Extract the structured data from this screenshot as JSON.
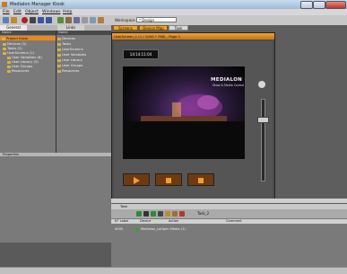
{
  "window": {
    "title": "Medialon Manager Kiosk"
  },
  "menu": {
    "items": [
      "File",
      "Edit",
      "Object",
      "Windows",
      "Help"
    ]
  },
  "toolbar": {
    "workspace_label": "Workspace",
    "workspace_value": "* Design"
  },
  "left": {
    "tabs": [
      "General",
      "Links"
    ],
    "col1_header": "Name",
    "col2_header": "Name",
    "tree": [
      "Project Kiosk",
      "Devices (5)",
      "Tasks (2)",
      "UserScreens (1)",
      "User Variables (6)",
      "User Library (0)",
      "User Groups",
      "Resources"
    ],
    "list": [
      "Devices",
      "Tasks",
      "UserScreens",
      "User Variables",
      "User Library",
      "User Groups",
      "Resources"
    ],
    "properties_title": "Properties"
  },
  "screens": {
    "tabs": [
      "Screens",
      "Device Map",
      "Task"
    ],
    "window_title": "UserScreen_1 (1 / 1000 * 768) - Page 1",
    "timecode": "14:14:11:04",
    "logo_main": "MEDIALON",
    "logo_sub": "Show & Media Control"
  },
  "task": {
    "header": "Task",
    "name": "Task_2",
    "columns": [
      "N° Label",
      "Device",
      "Action",
      "Comment"
    ],
    "rows": [
      {
        "n": "0000",
        "device": "Medialon_Lo",
        "action": "Open Media (1)"
      }
    ]
  }
}
